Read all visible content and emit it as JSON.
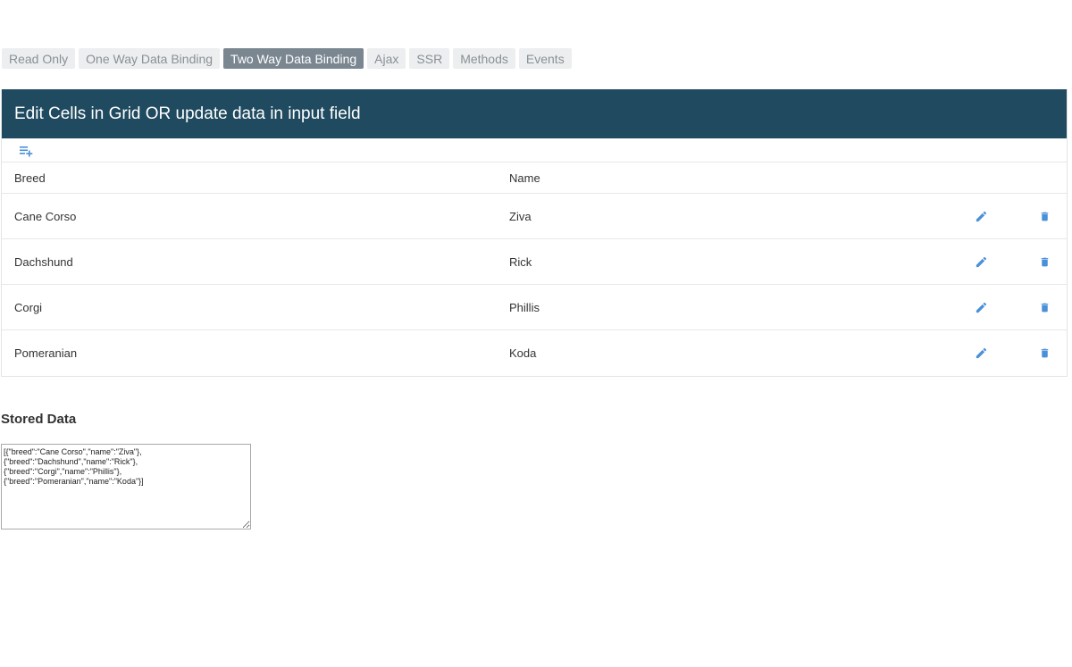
{
  "tabs": [
    {
      "label": "Read Only",
      "active": false
    },
    {
      "label": "One Way Data Binding",
      "active": false
    },
    {
      "label": "Two Way Data Binding",
      "active": true
    },
    {
      "label": "Ajax",
      "active": false
    },
    {
      "label": "SSR",
      "active": false
    },
    {
      "label": "Methods",
      "active": false
    },
    {
      "label": "Events",
      "active": false
    }
  ],
  "grid": {
    "title": "Edit Cells in Grid OR update data in input field",
    "columns": {
      "breed": "Breed",
      "name": "Name"
    },
    "rows": [
      {
        "breed": "Cane Corso",
        "name": "Ziva"
      },
      {
        "breed": "Dachshund",
        "name": "Rick"
      },
      {
        "breed": "Corgi",
        "name": "Phillis"
      },
      {
        "breed": "Pomeranian",
        "name": "Koda"
      }
    ]
  },
  "stored": {
    "title": "Stored Data",
    "value": "[{\"breed\":\"Cane Corso\",\"name\":\"Ziva\"},\n{\"breed\":\"Dachshund\",\"name\":\"Rick\"},\n{\"breed\":\"Corgi\",\"name\":\"Phillis\"},\n{\"breed\":\"Pomeranian\",\"name\":\"Koda\"}]"
  },
  "colors": {
    "header_bg": "#1f4a5f",
    "icon_blue": "#4a90d9",
    "tab_active_bg": "#7a8791",
    "tab_bg": "#eceeef"
  },
  "icons": {
    "add_row": "playlist-add-icon",
    "edit": "pencil-icon",
    "delete": "trash-icon"
  }
}
